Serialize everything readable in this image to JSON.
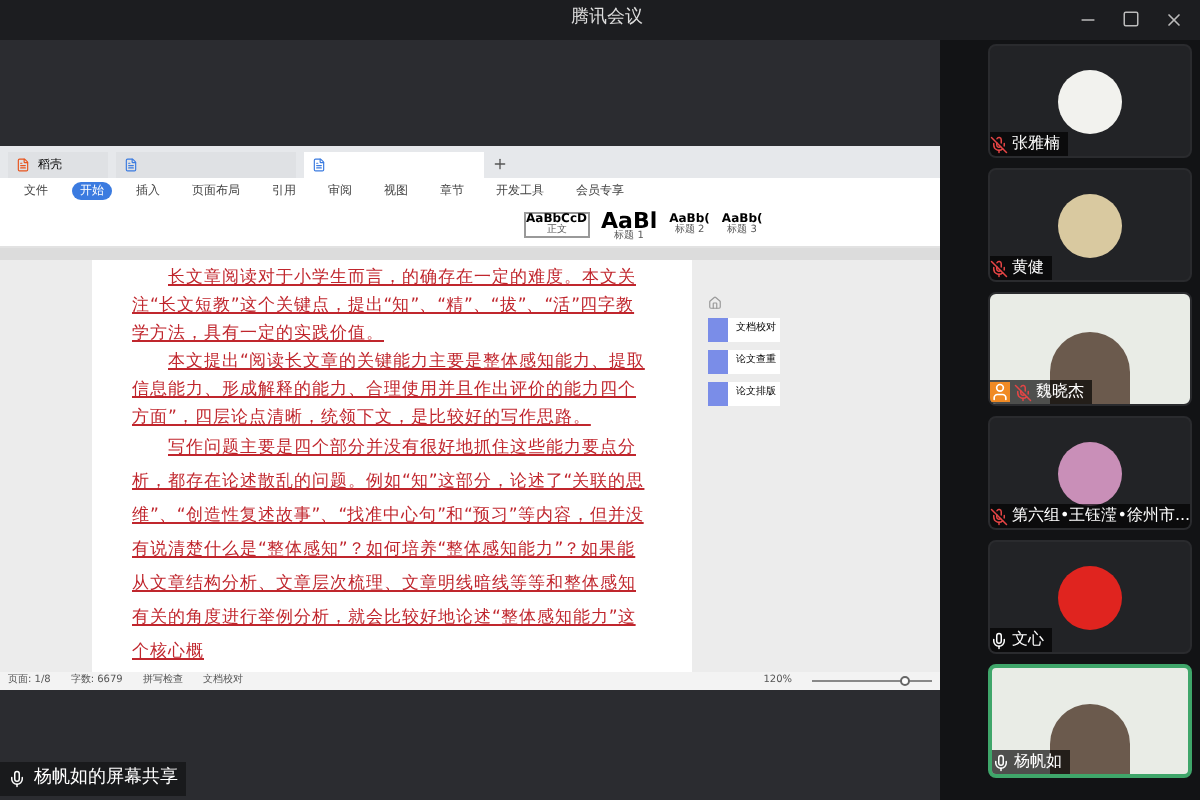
{
  "window": {
    "title": "腾讯会议"
  },
  "share": {
    "label": "杨帆如的屏幕共享",
    "wps": {
      "tabs": [
        {
          "label": "稻壳",
          "selected": false
        },
        {
          "selected": false
        },
        {
          "selected": true
        }
      ],
      "menu": [
        {
          "label": "文件",
          "selected": false
        },
        {
          "label": "开始",
          "selected": true
        },
        {
          "label": "插入",
          "selected": false
        },
        {
          "label": "页面布局",
          "selected": false
        },
        {
          "label": "引用",
          "selected": false
        },
        {
          "label": "审阅",
          "selected": false
        },
        {
          "label": "视图",
          "selected": false
        },
        {
          "label": "章节",
          "selected": false
        },
        {
          "label": "开发工具",
          "selected": false
        },
        {
          "label": "会员专享",
          "selected": false
        }
      ],
      "styles": [
        {
          "preview": "AaBbCcD",
          "label": "正文",
          "selected": true
        },
        {
          "preview": "AaBl",
          "label": "标题 1",
          "selected": false
        },
        {
          "preview": "AaBb(",
          "label": "标题 2",
          "selected": false
        },
        {
          "preview": "AaBb(",
          "label": "标题 3",
          "selected": false
        }
      ],
      "paragraphs": [
        {
          "text": "长文章阅读对于小学生而言，的确存在一定的难度。本文关注“长文短教”这个关键点，提出“知”、“精”、“拔”、“活”四字教学方法，具有一定的实践价值。",
          "kind": "tight"
        },
        {
          "text": "本文提出“阅读长文章的关键能力主要是整体感知能力、提取信息能力、形成解释的能力、合理使用并且作出评价的能力四个方面”，四层论点清晰，统领下文，是比较好的写作思路。",
          "kind": "tight"
        },
        {
          "text": "写作问题主要是四个部分并没有很好地抓住这些能力要点分析，都存在论述散乱的问题。例如“知”这部分，论述了“关联的思维”、“创造性复述故事”、“找准中心句”和“预习”等内容，但并没有说清楚什么是“整体感知”？如何培养“整体感知能力”？如果能从文章结构分析、文章层次梳理、文章明线暗线等等和整体感知有关的角度进行举例分析，就会比较好地论述“整体感知能力”这个核心概",
          "kind": "loose"
        }
      ],
      "side_panel": [
        "文档校对",
        "论文查重",
        "论文排版"
      ],
      "status": [
        "页面: 1/8",
        "字数: 6679",
        "拼写检查",
        "文档校对"
      ],
      "zoom": {
        "reading": "120%",
        "level": 0.8
      }
    }
  },
  "participants": [
    {
      "name": "张雅楠",
      "kind": "avatar",
      "muted": true,
      "active": false,
      "color": "#f2f2ee"
    },
    {
      "name": "黄健",
      "kind": "avatar",
      "muted": true,
      "active": false,
      "color": "#d9c9a0"
    },
    {
      "name": "魏晓杰",
      "kind": "video",
      "muted": true,
      "active": false
    },
    {
      "name": "第六组•王钰滢•徐州市...",
      "kind": "avatar",
      "muted": true,
      "active": false,
      "color": "#c98fb8"
    },
    {
      "name": "文心",
      "kind": "avatar",
      "muted": false,
      "active": false,
      "color": "#e0241f"
    },
    {
      "name": "杨帆如",
      "kind": "video",
      "muted": false,
      "active": true
    }
  ]
}
